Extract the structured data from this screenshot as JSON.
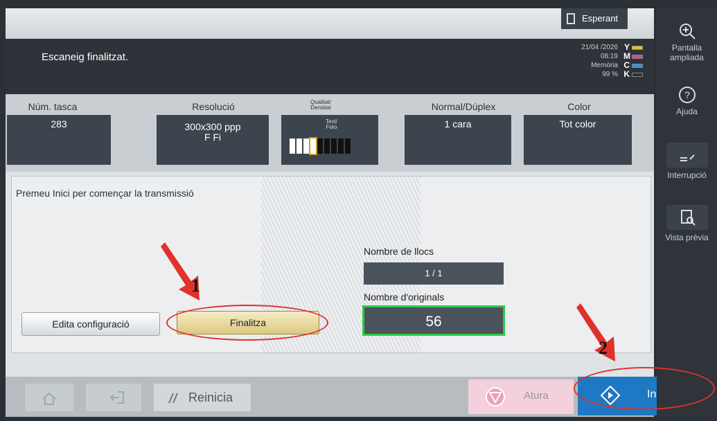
{
  "status": {
    "indicator": "Esperant",
    "message": "Escaneig finalitzat.",
    "date": "21/04 /2026",
    "time": "08:19",
    "memory_label": "Memòria",
    "memory_value": "99 %",
    "toner": [
      {
        "letter": "Y",
        "color": "#e8c21a"
      },
      {
        "letter": "M",
        "color": "#d04aa0"
      },
      {
        "letter": "C",
        "color": "#3a8fd8"
      },
      {
        "letter": "K",
        "color": "#2b3036"
      }
    ]
  },
  "settings": {
    "job_label": "Núm. tasca",
    "job_value": "283",
    "resolution_label": "Resolució",
    "resolution_value_1": "300x300 ppp",
    "resolution_value_2": "F Fi",
    "quality_label_1": "Qualitat/",
    "quality_label_2": "Densitat",
    "quality_value_1": "Text/",
    "quality_value_2": "Foto",
    "density_level": 4,
    "density_steps": 9,
    "duplex_label": "Normal/Dúplex",
    "duplex_value": "1 cara",
    "color_label": "Color",
    "color_value": "Tot color"
  },
  "content": {
    "instruction": "Premeu Inici per començar la transmissió",
    "places_label": "Nombre de llocs",
    "places_value": "1  /  1",
    "originals_label": "Nombre d'originals",
    "originals_value": "56",
    "edit_button": "Edita configuració",
    "finish_button": "Finalitza"
  },
  "bottom": {
    "reset": "Reinicia",
    "stop": "Atura",
    "start": "Inicia"
  },
  "sidebar": {
    "zoom_1": "Pantalla",
    "zoom_2": "ampliada",
    "help": "Ajuda",
    "interrupt": "Interrupció",
    "preview": "Vista prèvia"
  },
  "annotations": {
    "step_1": "1",
    "step_2": "2",
    "color": "#e0312b"
  }
}
